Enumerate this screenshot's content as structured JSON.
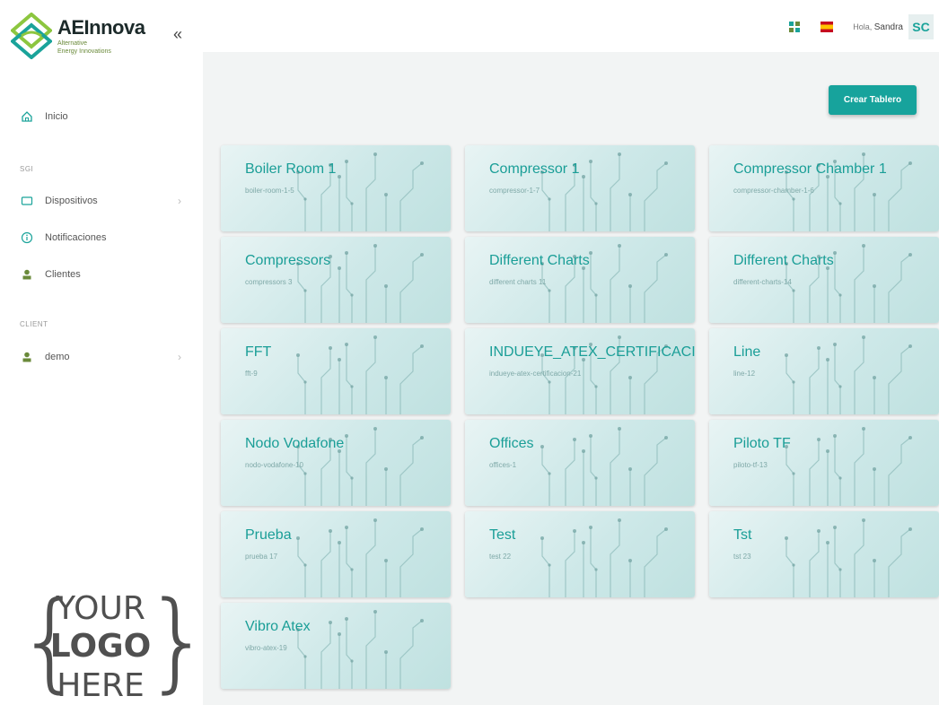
{
  "brand": {
    "name": "AEInnova",
    "tagline_line1": "Alternative",
    "tagline_line2": "Energy Innovations"
  },
  "sidebar": {
    "collapse_glyph": "«",
    "items": [
      {
        "label": "Inicio",
        "icon": "home-icon"
      },
      {
        "label": "Dispositivos",
        "icon": "device-icon",
        "chevron": "›"
      },
      {
        "label": "Notificaciones",
        "icon": "info-icon"
      },
      {
        "label": "Clientes",
        "icon": "person-icon"
      },
      {
        "label": "demo",
        "icon": "person-icon",
        "chevron": "›"
      }
    ],
    "sections": [
      "SGI",
      "CLIENT"
    ]
  },
  "placeholder_logo": {
    "line1": "YOUR",
    "line2": "LOGO",
    "line3": "HERE"
  },
  "topbar": {
    "greeting": "Hola,",
    "user_name": "Sandra",
    "avatar_initials": "SC"
  },
  "actions": {
    "create_dashboard": "Crear Tablero"
  },
  "colors": {
    "accent": "#17a39c",
    "card_title": "#1a9e97"
  },
  "dashboards": [
    {
      "title": "Boiler Room 1",
      "slug": "boiler-room-1-5"
    },
    {
      "title": "Compressor 1",
      "slug": "compressor-1-7"
    },
    {
      "title": "Compressor Chamber 1",
      "slug": "compressor-chamber-1-6"
    },
    {
      "title": "Compressors",
      "slug": "compressors 3"
    },
    {
      "title": "Different Charts",
      "slug": "different charts 11"
    },
    {
      "title": "Different Charts",
      "slug": "different-charts-14"
    },
    {
      "title": "FFT",
      "slug": "fft-9"
    },
    {
      "title": "INDUEYE_ATEX_CERTIFICACION",
      "slug": "indueye-atex-certificacion-21"
    },
    {
      "title": "Line",
      "slug": "line-12"
    },
    {
      "title": "Nodo Vodafone",
      "slug": "nodo-vodafone-10"
    },
    {
      "title": "Offices",
      "slug": "offices-1"
    },
    {
      "title": "Piloto TF",
      "slug": "piloto-tf-13"
    },
    {
      "title": "Prueba",
      "slug": "prueba 17"
    },
    {
      "title": "Test",
      "slug": "test 22"
    },
    {
      "title": "Tst",
      "slug": "tst 23"
    },
    {
      "title": "Vibro Atex",
      "slug": "vibro-atex-19"
    }
  ]
}
